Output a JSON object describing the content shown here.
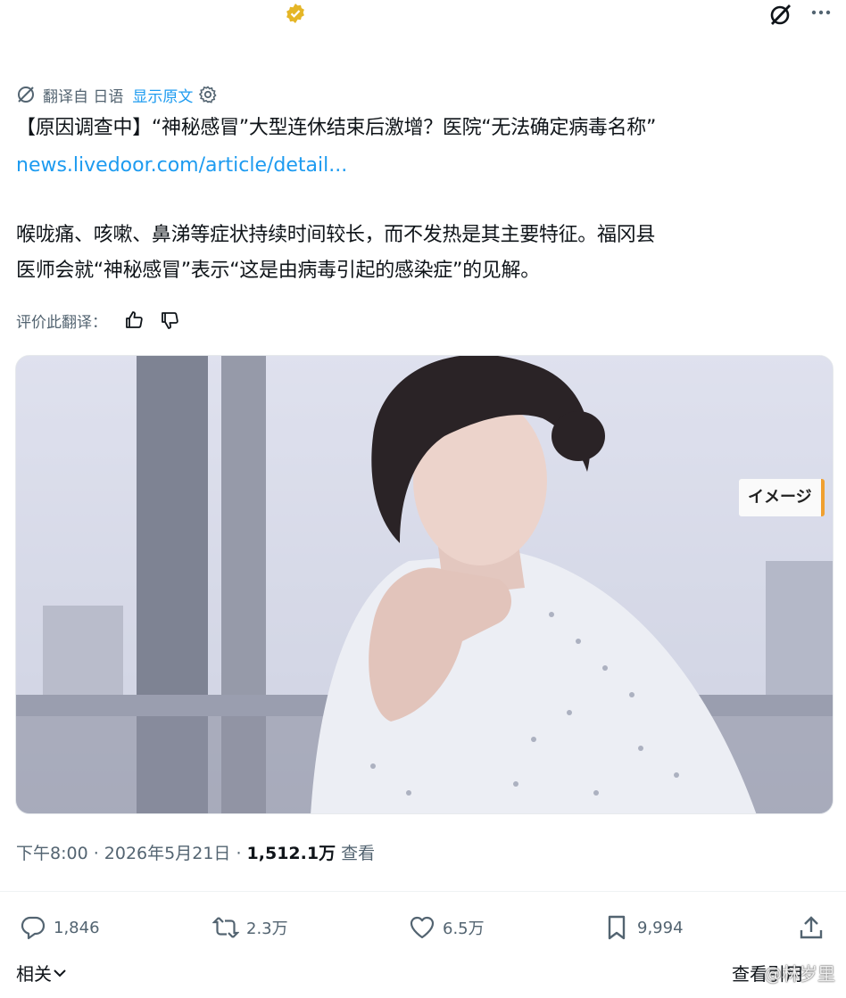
{
  "header": {
    "verified_icon": "verified-badge-icon",
    "grok_icon": "grok-icon",
    "more_icon": "more-icon"
  },
  "translation": {
    "from_label": "翻译自 日语",
    "show_original": "显示原文"
  },
  "tweet": {
    "title": "【原因调查中】“神秘感冒”大型连休结束后激增？医院“无法确定病毒名称”",
    "link": "news.livedoor.com/article/detail...",
    "body_line1": "喉咙痛、咳嗽、鼻涕等症状持续时间较长，而不发热是其主要特征。福冈县",
    "body_line2": "医师会就“神秘感冒”表示“这是由病毒引起的感染症”的见解。",
    "rate_label": "评价此翻译：",
    "image_badge": "イメージ"
  },
  "meta": {
    "time": "下午8:00 · 2026年5月21日 · ",
    "views": "1,512.1万",
    "views_label": " 查看"
  },
  "actions": {
    "replies": "1,846",
    "reposts": "2.3万",
    "likes": "6.5万",
    "bookmarks": "9,994"
  },
  "bottom": {
    "related": "相关",
    "quotes": "查看引用",
    "watermark": "@林岁里"
  },
  "colors": {
    "accent": "#1d9bf0",
    "verified": "#e5b627",
    "secondary": "#536471"
  }
}
